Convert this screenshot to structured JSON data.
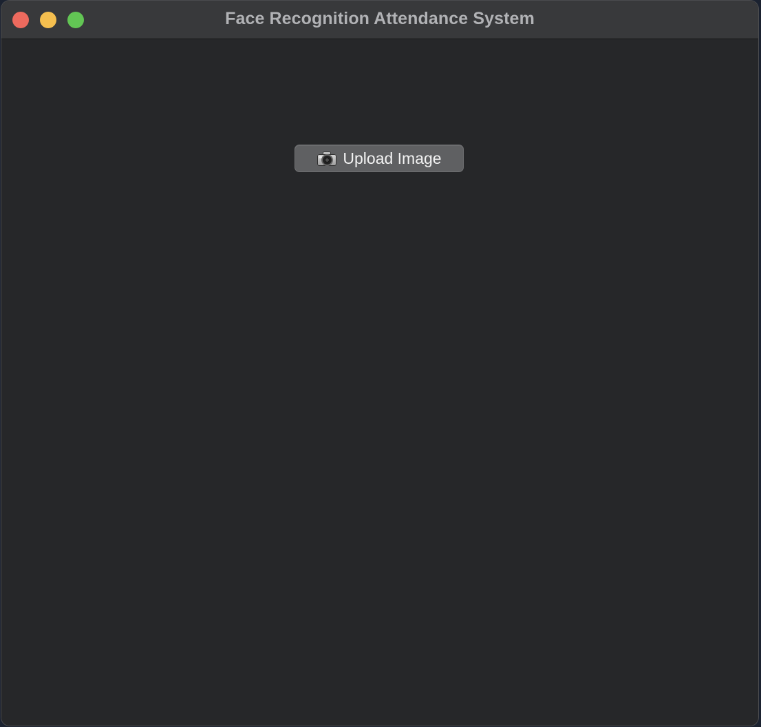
{
  "window": {
    "title": "Face Recognition Attendance System",
    "controls": {
      "close_color": "#ed6a5e",
      "minimize_color": "#f5bf4f",
      "zoom_color": "#62c554"
    }
  },
  "main": {
    "upload_button": {
      "icon": "camera-icon",
      "label": "Upload Image"
    }
  },
  "colors": {
    "window_background": "#262729",
    "titlebar_background": "#38393b",
    "title_text": "#b1b2b5",
    "button_background": "#5f6062",
    "button_text": "#f2f2f2"
  }
}
